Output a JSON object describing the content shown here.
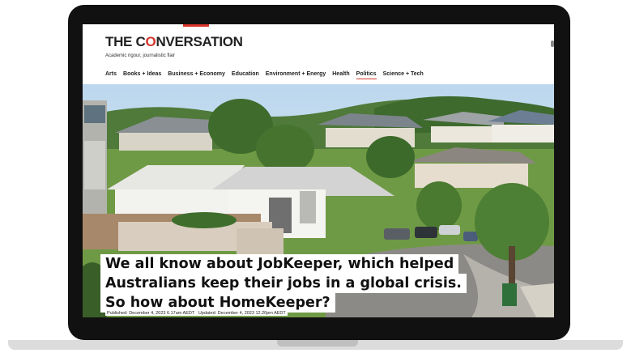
{
  "site": {
    "logo_text_pre": "THE C",
    "logo_text_o": "O",
    "logo_text_post": "NVERSATION",
    "tagline": "Academic rigour, journalistic flair"
  },
  "nav": {
    "items": [
      "Arts",
      "Books + Ideas",
      "Business + Economy",
      "Education",
      "Environment + Energy",
      "Health",
      "Politics",
      "Science + Tech"
    ],
    "active": "Politics"
  },
  "article": {
    "headline_lines": [
      "We all know about JobKeeper, which helped",
      "Australians keep their jobs in a global crisis.",
      "So how about HomeKeeper?"
    ],
    "published": "Published: December 4, 2023 6.17am AEDT",
    "updated": "Updated: December 4, 2023 12.20pm AEDT"
  },
  "colors": {
    "accent": "#d8352a",
    "frame": "#111111"
  }
}
